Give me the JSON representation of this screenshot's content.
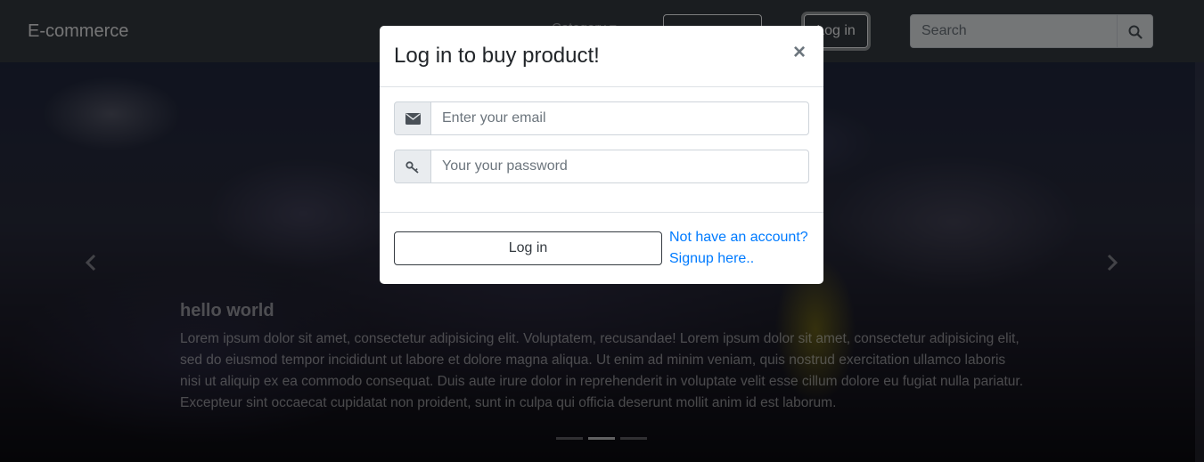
{
  "navbar": {
    "brand": "E-commerce",
    "category_label": "Category ▾",
    "login_label": "Log in",
    "search": {
      "placeholder": "Search",
      "icon": "search-icon"
    }
  },
  "hero": {
    "caption_title": "hello world",
    "caption_text": "Lorem ipsum dolor sit amet, consectetur adipisicing elit. Voluptatem, recusandae! Lorem ipsum dolor sit amet, consectetur adipisicing elit, sed do eiusmod tempor incididunt ut labore et dolore magna aliqua. Ut enim ad minim veniam, quis nostrud exercitation ullamco laboris nisi ut aliquip ex ea commodo consequat. Duis aute irure dolor in reprehenderit in voluptate velit esse cillum dolore eu fugiat nulla pariatur. Excepteur sint occaecat cupidatat non proident, sunt in culpa qui officia deserunt mollit anim id est laborum.",
    "indicators": 3,
    "active_indicator": 1
  },
  "modal": {
    "title": "Log in to buy product!",
    "close_symbol": "×",
    "email": {
      "placeholder": "Enter your email",
      "icon": "envelope-icon"
    },
    "password": {
      "placeholder": "Your your password",
      "icon": "key-icon"
    },
    "login_button": "Log in",
    "signup_line1": "Not have an account?",
    "signup_line2": "Signup here.."
  },
  "colors": {
    "navbar_bg": "#343a40",
    "link": "#007bff",
    "modal_bg": "#ffffff"
  }
}
